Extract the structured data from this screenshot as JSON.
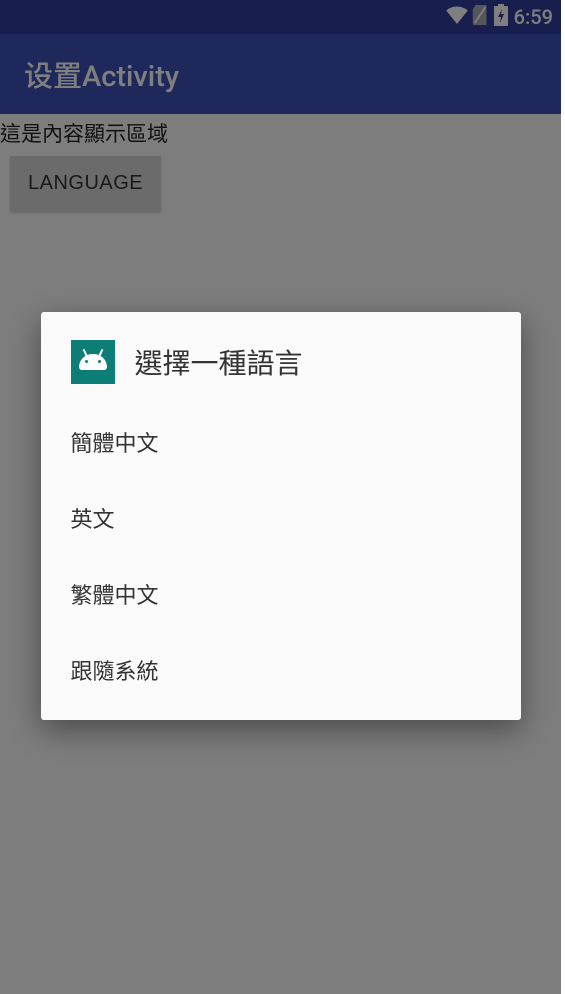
{
  "statusBar": {
    "time": "6:59"
  },
  "actionBar": {
    "title": "设置Activity"
  },
  "content": {
    "label": "這是內容顯示區域",
    "languageButton": "LANGUAGE"
  },
  "dialog": {
    "title": "選擇一種語言",
    "items": [
      "簡體中文",
      "英文",
      "繁體中文",
      "跟隨系統"
    ]
  }
}
